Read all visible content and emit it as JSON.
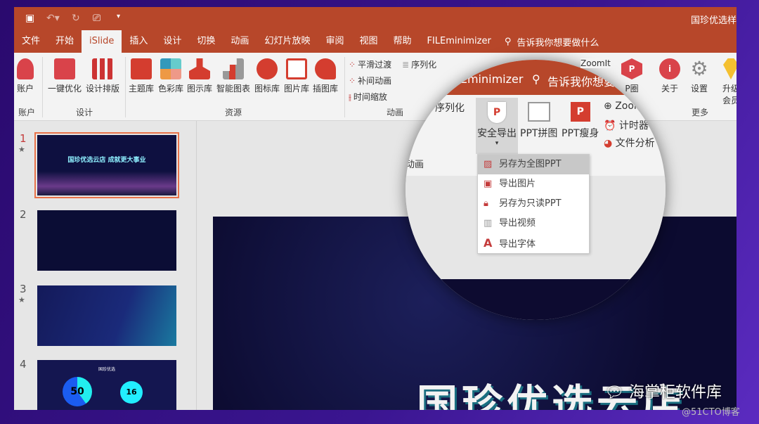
{
  "window": {
    "title": "国珍优选样"
  },
  "quick_access": [
    "save-icon",
    "undo-icon",
    "redo-icon",
    "present-icon",
    "customize-icon"
  ],
  "tabs": [
    "文件",
    "开始",
    "iSlide",
    "插入",
    "设计",
    "切换",
    "动画",
    "幻灯片放映",
    "审阅",
    "视图",
    "帮助",
    "FILEminimizer"
  ],
  "active_tab": "iSlide",
  "tell_me": "告诉我你想要做什么",
  "ribbon": {
    "account": {
      "button": "账户",
      "group": "账户"
    },
    "design": {
      "buttons": [
        "一键优化",
        "设计排版"
      ],
      "group": "设计"
    },
    "resources": {
      "buttons": [
        "主题库",
        "色彩库",
        "图示库",
        "智能图表",
        "图标库",
        "图片库",
        "插图库"
      ],
      "group": "资源"
    },
    "animation": {
      "items": [
        "平滑过渡",
        "补间动画",
        "时间缩放",
        "序列化"
      ],
      "group": "动画"
    },
    "zoomit": "ZoomIt",
    "more": {
      "buttons": [
        "P圈",
        "关于",
        "设置",
        "升级会员"
      ],
      "group": "更多"
    }
  },
  "magnifier": {
    "tab": "FILEminimizer",
    "tell_me": "告诉我你想要做",
    "serialize": "序列化",
    "anim_group": "动画",
    "buttons": [
      "安全导出",
      "PPT拼图",
      "PPT瘦身"
    ],
    "small": [
      "Zoom",
      "计时器",
      "文件分析"
    ],
    "menu": [
      "另存为全图PPT",
      "导出图片",
      "另存为只读PPT",
      "导出视频",
      "导出字体"
    ]
  },
  "slides": [
    {
      "num": "1",
      "starred": true,
      "title": "国珍优选云店  成就更大事业"
    },
    {
      "num": "2",
      "starred": false
    },
    {
      "num": "3",
      "starred": true
    },
    {
      "num": "4",
      "starred": false,
      "title": "国珍优选",
      "values": [
        "50",
        "16"
      ]
    }
  ],
  "current_slide_title": "国珍优选云店",
  "watermark": "海掌柜软件库",
  "watermark2": "@51CTO博客",
  "colors": {
    "accent": "#b7472a",
    "selection": "#e8734a"
  }
}
